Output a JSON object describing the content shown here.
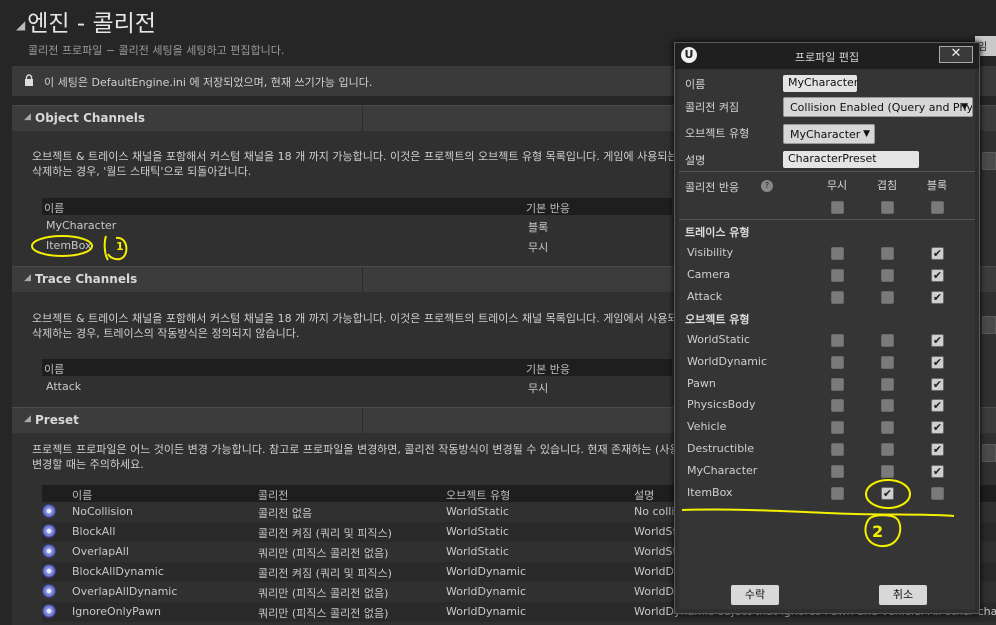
{
  "page": {
    "title": "엔진 - 콜리전",
    "subtitle": "콜리전 프로파일 − 콜리전 세팅을 세팅하고 편집합니다.",
    "top_right_button": "임",
    "lock_notice": "이 세팅은 DefaultEngine.ini 에 저장되었으며, 현재 쓰기가능 입니다."
  },
  "object_channels": {
    "header": "Object Channels",
    "desc_line1": "오브젝트 & 트레이스 채널을 포함해서 커스텀 채널을 18 개 까지 가능합니다. 이것은 프로젝트의 오브젝트 유형 목록입니다. 게임에 사용되는",
    "desc_line2": "삭제하는 경우, '월드 스태틱'으로 되돌아갑니다.",
    "col_name": "이름",
    "col_default": "기본 반응",
    "rows": [
      {
        "name": "MyCharacter",
        "default": "블록"
      },
      {
        "name": "ItemBox",
        "default": "무시"
      }
    ]
  },
  "trace_channels": {
    "header": "Trace Channels",
    "desc_line1": "오브젝트 & 트레이스 채널을 포함해서 커스텀 채널을 18 개 까지 가능합니다. 이것은 프로젝트의 트레이스 채널 목록입니다. 게임에서 사용되는",
    "desc_line2": "삭제하는 경우, 트레이스의 작동방식은 정의되지 않습니다.",
    "col_name": "이름",
    "col_default": "기본 반응",
    "rows": [
      {
        "name": "Attack",
        "default": "무시"
      }
    ]
  },
  "preset": {
    "header": "Preset",
    "desc_line1": "프로젝트 프로파일은 어느 것이든 변경 가능합니다. 참고로 프로파일을 변경하면, 콜리전 작동방식이 변경될 수 있습니다. 현재 존재하는 (사용",
    "desc_line2": "변경할 때는 주의하세요.",
    "col_name": "이름",
    "col_collision": "콜리전",
    "col_object_type": "오브젝트 유형",
    "col_desc": "설명",
    "rows": [
      {
        "name": "NoCollision",
        "collision": "콜리전 없음",
        "object_type": "WorldStatic",
        "desc": "No colli"
      },
      {
        "name": "BlockAll",
        "collision": "콜리전 켜짐 (쿼리 및 피직스)",
        "object_type": "WorldStatic",
        "desc": "WorldSt"
      },
      {
        "name": "OverlapAll",
        "collision": "쿼리만 (피직스 콜리전 없음)",
        "object_type": "WorldStatic",
        "desc": "WorldSt"
      },
      {
        "name": "BlockAllDynamic",
        "collision": "콜리전 켜짐 (쿼리 및 피직스)",
        "object_type": "WorldDynamic",
        "desc": "WorldDy"
      },
      {
        "name": "OverlapAllDynamic",
        "collision": "쿼리만 (피직스 콜리전 없음)",
        "object_type": "WorldDynamic",
        "desc": "WorldDy"
      },
      {
        "name": "IgnoreOnlyPawn",
        "collision": "쿼리만 (피직스 콜리전 없음)",
        "object_type": "WorldDynamic",
        "desc": "WorldDynamic object that ignores Pawn and Vehicle. All other channels w"
      }
    ]
  },
  "dialog": {
    "title": "프로파일 편집",
    "close": "✕",
    "name_label": "이름",
    "name_value": "MyCharacter",
    "collision_label": "콜리전 켜짐",
    "collision_value": "Collision Enabled (Query and Phy",
    "object_type_label": "오브젝트 유형",
    "object_type_value": "MyCharacter",
    "desc_label": "설명",
    "desc_value": "CharacterPreset",
    "response_label": "콜리전 반응",
    "col_ignore": "무시",
    "col_overlap": "겹침",
    "col_block": "블록",
    "trace_group": "트레이스 유형",
    "object_group": "오브젝트 유형",
    "all_row": [
      false,
      false,
      false
    ],
    "trace_rows": [
      {
        "name": "Visibility",
        "checks": [
          false,
          false,
          true
        ]
      },
      {
        "name": "Camera",
        "checks": [
          false,
          false,
          true
        ]
      },
      {
        "name": "Attack",
        "checks": [
          false,
          false,
          true
        ]
      }
    ],
    "object_rows": [
      {
        "name": "WorldStatic",
        "checks": [
          false,
          false,
          true
        ]
      },
      {
        "name": "WorldDynamic",
        "checks": [
          false,
          false,
          true
        ]
      },
      {
        "name": "Pawn",
        "checks": [
          false,
          false,
          true
        ]
      },
      {
        "name": "PhysicsBody",
        "checks": [
          false,
          false,
          true
        ]
      },
      {
        "name": "Vehicle",
        "checks": [
          false,
          false,
          true
        ]
      },
      {
        "name": "Destructible",
        "checks": [
          false,
          false,
          true
        ]
      },
      {
        "name": "MyCharacter",
        "checks": [
          false,
          false,
          true
        ]
      },
      {
        "name": "ItemBox",
        "checks": [
          false,
          true,
          false
        ]
      }
    ],
    "accept": "수락",
    "cancel": "취소"
  },
  "annotations": {
    "mark1": "1",
    "mark2": "2",
    "color": "#f5f000"
  }
}
